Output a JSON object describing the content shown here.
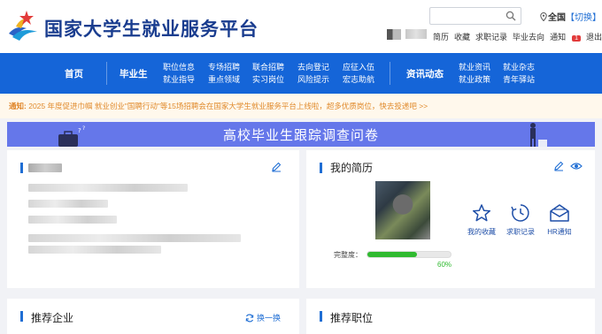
{
  "header": {
    "site_title": "国家大学生就业服务平台",
    "search_placeholder": "",
    "location_city": "全国",
    "location_switch": "【切换】",
    "user_links": [
      "简历",
      "收藏",
      "求职记录",
      "毕业去向",
      "通知",
      "退出"
    ],
    "notification_count": "1"
  },
  "nav": {
    "home": "首页",
    "graduate": "毕业生",
    "graduate_links": [
      [
        "职位信息",
        "就业指导"
      ],
      [
        "专场招聘",
        "重点领域"
      ],
      [
        "联合招聘",
        "实习岗位"
      ],
      [
        "去向登记",
        "风险提示"
      ],
      [
        "应征入伍",
        "宏志助航"
      ]
    ],
    "dynamics": "资讯动态",
    "dynamics_links": [
      [
        "就业资讯",
        "就业政策"
      ],
      [
        "就业杂志",
        "青年驿站"
      ]
    ]
  },
  "notice": {
    "label": "通知:",
    "text": "2025 年度促进巾帼 就业创业\"国聘行动\"等15场招聘会在国家大学生就业服务平台上线啦，超多优质岗位，快去投递吧 >>"
  },
  "banner": {
    "title": "高校毕业生跟踪调查问卷"
  },
  "resume": {
    "title": "我的简历",
    "completeness_label": "完整度：",
    "completeness_value": 60,
    "completeness_text": "60%",
    "actions": [
      "我的收藏",
      "求职记录",
      "HR通知"
    ]
  },
  "recommend_company": {
    "title": "推荐企业",
    "refresh_label": "换一换"
  },
  "recommend_job": {
    "title": "推荐职位"
  },
  "colors": {
    "nav_bg": "#1565d8",
    "banner_bg": "#6577ea",
    "accent": "#1f6ed4",
    "progress": "#2fba2f",
    "badge": "#e23b3b"
  }
}
